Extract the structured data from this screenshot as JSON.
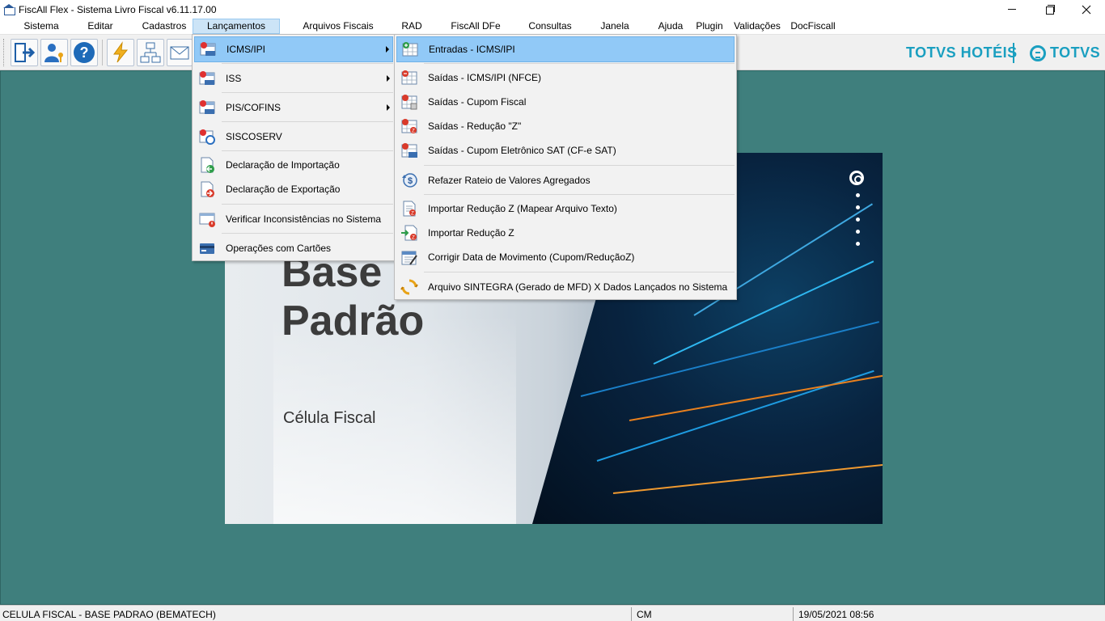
{
  "window": {
    "title": "FiscAll Flex - Sistema Livro Fiscal v6.11.17.00"
  },
  "menubar": {
    "items": [
      {
        "label": "Sistema"
      },
      {
        "label": "Editar"
      },
      {
        "label": "Cadastros"
      },
      {
        "label": "Lançamentos"
      },
      {
        "label": "Arquivos Fiscais"
      },
      {
        "label": "RAD"
      },
      {
        "label": "FiscAll DFe"
      },
      {
        "label": "Consultas"
      },
      {
        "label": "Janela"
      },
      {
        "label": "Ajuda"
      },
      {
        "label": "Plugin"
      },
      {
        "label": "Validações"
      },
      {
        "label": "DocFiscall"
      }
    ],
    "active": "Lançamentos"
  },
  "toolbar": {
    "icons": [
      "exit-icon",
      "user-key-icon",
      "help-icon",
      "lightning-icon",
      "network-icon",
      "mail-icon"
    ],
    "brand_hotels": "TOTVS HOTÉIS",
    "brand_totvs": "TOTVS",
    "accent": "#1a9fc0"
  },
  "splash": {
    "line1": "Base",
    "line2": "Padrão",
    "subtitle": "Célula Fiscal"
  },
  "lancamentos_menu": {
    "items": [
      {
        "label": "ICMS/IPI",
        "icon": "icms-ipi-icon",
        "submenu": true,
        "selected": true
      },
      {
        "label": "ISS",
        "icon": "iss-icon",
        "submenu": true
      },
      {
        "label": "PIS/COFINS",
        "icon": "pis-cofins-icon",
        "submenu": true
      },
      {
        "label": "SISCOSERV",
        "icon": "siscoserv-icon",
        "submenu": false
      },
      {
        "label": "Declaração de Importação",
        "icon": "import-declaration-icon",
        "submenu": false
      },
      {
        "label": "Declaração de Exportação",
        "icon": "export-declaration-icon",
        "submenu": false
      },
      {
        "label": "Verificar Inconsistências no Sistema",
        "icon": "inconsistency-icon",
        "submenu": false
      },
      {
        "label": "Operações com Cartões",
        "icon": "card-icon",
        "submenu": false
      }
    ]
  },
  "icms_submenu": {
    "items": [
      {
        "label": "Entradas - ICMS/IPI",
        "icon": "entries-icon",
        "selected": true
      },
      {
        "label": "Saídas - ICMS/IPI (NFCE)",
        "icon": "exits-nfce-icon"
      },
      {
        "label": "Saídas - Cupom Fiscal",
        "icon": "exits-coupon-icon"
      },
      {
        "label": "Saídas - Redução \"Z\"",
        "icon": "exits-reduction-z-icon"
      },
      {
        "label": "Saídas - Cupom Eletrônico SAT (CF-e SAT)",
        "icon": "exits-sat-icon"
      },
      {
        "label": "Refazer Rateio de Valores Agregados",
        "icon": "redo-apportionment-icon"
      },
      {
        "label": "Importar Redução Z (Mapear Arquivo Texto)",
        "icon": "import-z-text-icon"
      },
      {
        "label": "Importar Redução Z",
        "icon": "import-z-icon"
      },
      {
        "label": "Corrigir Data de Movimento (Cupom/ReduçãoZ)",
        "icon": "fix-date-icon"
      },
      {
        "label": "Arquivo SINTEGRA (Gerado de MFD) X Dados Lançados no Sistema",
        "icon": "sintegra-icon"
      }
    ]
  },
  "statusbar": {
    "company": "CELULA FISCAL - BASE PADRAO (BEMATECH)",
    "code": "CM",
    "datetime": "19/05/2021 08:56"
  }
}
